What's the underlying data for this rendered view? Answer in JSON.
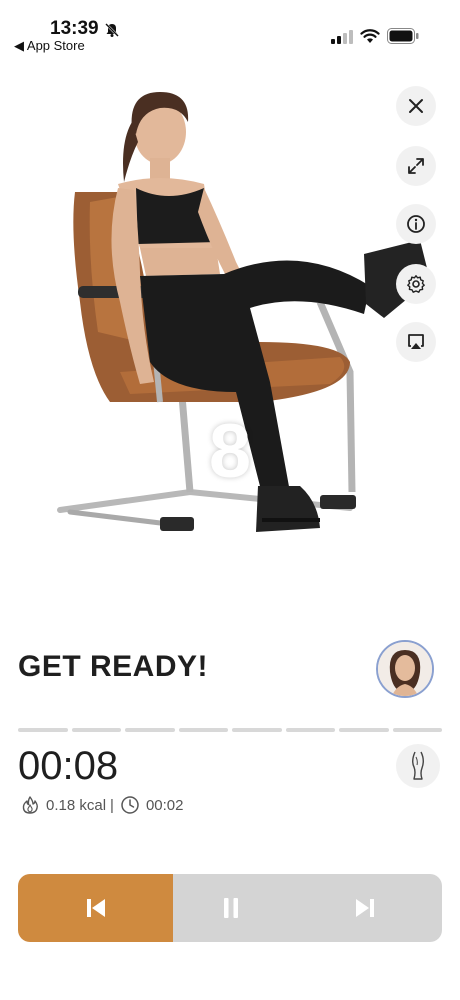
{
  "status_bar": {
    "time": "13:39",
    "back_label": "◀ App Store",
    "icons": [
      "bell-muted-icon",
      "signal-icon",
      "wifi-icon",
      "battery-icon"
    ]
  },
  "video": {
    "countdown": "8",
    "side_buttons": [
      "close-icon",
      "expand-icon",
      "info-icon",
      "settings-icon",
      "airplay-icon"
    ]
  },
  "exercise": {
    "title": "GET READY!",
    "progress_segments": 8,
    "timer": "00:08",
    "calories": "0.18 kcal",
    "separator": "|",
    "duration": "00:02"
  },
  "controls": {
    "buttons": [
      "previous-icon",
      "pause-icon",
      "next-icon"
    ]
  },
  "colors": {
    "accent": "#cf8a3f",
    "control_bg": "#d4d4d4",
    "side_button_bg": "#f1f1f1",
    "text": "#1f1f1f",
    "progress": "#d8d8d8"
  }
}
